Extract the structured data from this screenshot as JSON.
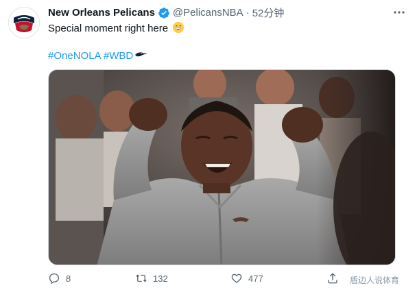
{
  "author": {
    "name": "New Orleans Pelicans",
    "handle": "@PelicansNBA",
    "separator": "·",
    "time": "52分钟",
    "avatar_logo_text": "NEW ORLEANS",
    "verified": true
  },
  "tweet": {
    "text": "Special moment right here",
    "emoji": "grinning-face-with-smiling-eyes",
    "hashtags": [
      "#OneNOLA",
      "#WBD"
    ]
  },
  "actions": {
    "replies": "8",
    "retweets": "132",
    "likes": "477"
  },
  "watermark": "盾边人说体育",
  "colors": {
    "accent": "#1d9bf0",
    "text": "#0f1419",
    "muted": "#536471",
    "pelicans_navy": "#0c2340",
    "pelicans_red": "#c8102e",
    "pelicans_gold": "#85714d"
  }
}
